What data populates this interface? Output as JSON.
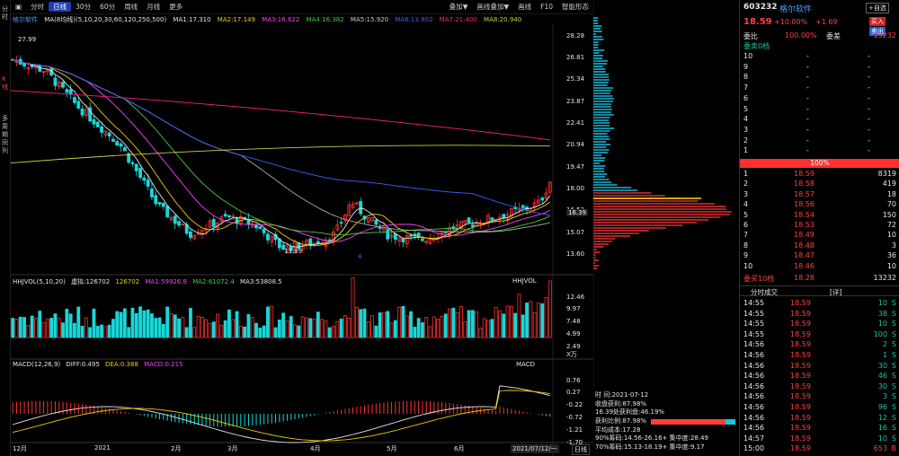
{
  "left_tabs": [
    "分时",
    "K线",
    "多周期同列"
  ],
  "toolbar": {
    "items": [
      "分时",
      "日线",
      "30分",
      "60分",
      "周线",
      "月线",
      "更多"
    ],
    "right_items": [
      "叠加▼",
      "画线叠加▼",
      "画线",
      "F10",
      "智能形态"
    ]
  },
  "ma_legend": {
    "name": "格尔软件",
    "label": "MA(8均线)(5,10,20,30,60,120,250,500)",
    "values": [
      {
        "text": "MA1:17.310",
        "color": "#e6e6e6"
      },
      {
        "text": "MA2:17.149",
        "color": "#f0d000"
      },
      {
        "text": "MA3:16.622",
        "color": "#ff40ff"
      },
      {
        "text": "MA4:16.382",
        "color": "#40d040"
      },
      {
        "text": "MA5:15.920",
        "color": "#cccccc"
      },
      {
        "text": "MA6:13.902",
        "color": "#4060ff"
      },
      {
        "text": "MA7:21.400",
        "color": "#ff2080"
      },
      {
        "text": "MA8:20.940",
        "color": "#d0d040"
      }
    ]
  },
  "price_axis": [
    "28.28",
    "26.81",
    "25.34",
    "23.87",
    "22.41",
    "20.94",
    "19.47",
    "18.00",
    "16.53",
    "15.07",
    "13.60"
  ],
  "price_markers": {
    "high": "27.99",
    "low": "13.89",
    "current": "16.39",
    "marker_4": "4"
  },
  "vol_legend": {
    "label": "HHJVOL(5,10,20)",
    "values": [
      {
        "text": "虚拟:126702",
        "color": "#e6e6e6"
      },
      {
        "text": "126702",
        "color": "#f0d000"
      },
      {
        "text": "MA1:59926.8",
        "color": "#ff40ff"
      },
      {
        "text": "MA2:61072.4",
        "color": "#40d040"
      },
      {
        "text": "MA3:53808.5",
        "color": "#e6e6e6"
      }
    ],
    "right_label": "HHJVOL"
  },
  "vol_axis": [
    "12.46",
    "9.97",
    "7.48",
    "4.99",
    "2.49",
    "X万"
  ],
  "macd_legend": {
    "label": "MACD(12,26,9)",
    "values": [
      {
        "text": "DIFF:0.495",
        "color": "#e6e6e6"
      },
      {
        "text": "DEA:0.388",
        "color": "#f0d000"
      },
      {
        "text": "MACD:0.215",
        "color": "#ff40ff"
      }
    ],
    "right_label": "MACD"
  },
  "macd_axis": [
    "0.76",
    "0.27",
    "-0.22",
    "-0.72",
    "-1.21",
    "-1.70"
  ],
  "date_axis": [
    "12月",
    "2021",
    "2月",
    "3月",
    "4月",
    "5月",
    "6月"
  ],
  "date_current": "2021/07/12/一",
  "date_period": "日线",
  "chip_info": {
    "date": "时    间:2021-07-12",
    "lines": [
      "收盘获利:87.98%",
      "16.39处获利盘:46.19%",
      "获利比例:87.98%",
      "平均成本:17.28",
      "90%筹码:14.56-26.16+ 集中度:28.49",
      "70%筹码:15.13-18.19+ 集中度:9.17"
    ]
  },
  "quote": {
    "code": "603232",
    "name": "格尔软件",
    "self_select": "+自选",
    "price": "18.59",
    "change_pct": "+10.00%",
    "change": "+1.69",
    "buy_label": "买入",
    "sell_label": "卖出",
    "weibi_label": "委比",
    "weibi": "100.00%",
    "weicha_label": "委差",
    "weicha": "13232",
    "sell_total_label": "委卖0档",
    "sell_rows": [
      {
        "n": "10",
        "p": "-",
        "v": "-"
      },
      {
        "n": "9",
        "p": "-",
        "v": "-"
      },
      {
        "n": "8",
        "p": "-",
        "v": "-"
      },
      {
        "n": "7",
        "p": "-",
        "v": "-"
      },
      {
        "n": "6",
        "p": "-",
        "v": "-"
      },
      {
        "n": "5",
        "p": "-",
        "v": "-"
      },
      {
        "n": "4",
        "p": "-",
        "v": "-"
      },
      {
        "n": "3",
        "p": "-",
        "v": "-"
      },
      {
        "n": "2",
        "p": "-",
        "v": "-"
      },
      {
        "n": "1",
        "p": "-",
        "v": "-"
      }
    ],
    "ratio_bar": "100%",
    "buy_rows": [
      {
        "n": "1",
        "p": "18.59",
        "v": "8319"
      },
      {
        "n": "2",
        "p": "18.58",
        "v": "419"
      },
      {
        "n": "3",
        "p": "18.57",
        "v": "18"
      },
      {
        "n": "4",
        "p": "18.56",
        "v": "70"
      },
      {
        "n": "5",
        "p": "18.54",
        "v": "150"
      },
      {
        "n": "6",
        "p": "18.53",
        "v": "72"
      },
      {
        "n": "7",
        "p": "18.49",
        "v": "10"
      },
      {
        "n": "8",
        "p": "18.48",
        "v": "3"
      },
      {
        "n": "9",
        "p": "18.47",
        "v": "36"
      },
      {
        "n": "10",
        "p": "18.46",
        "v": "10"
      }
    ],
    "buy_total_label": "委买10档",
    "buy_total_price": "18.28",
    "buy_total_vol": "13232",
    "ticks_tab": "分时成交",
    "ticks_tab2": "[详]",
    "ticks": [
      {
        "t": "14:55",
        "p": "18.59",
        "v": "10",
        "f": "S"
      },
      {
        "t": "14:55",
        "p": "18.59",
        "v": "38",
        "f": "S"
      },
      {
        "t": "14:55",
        "p": "18.59",
        "v": "10",
        "f": "S"
      },
      {
        "t": "14:55",
        "p": "18.59",
        "v": "100",
        "f": "S"
      },
      {
        "t": "14:56",
        "p": "18.59",
        "v": "2",
        "f": "S"
      },
      {
        "t": "14:56",
        "p": "18.59",
        "v": "1",
        "f": "S"
      },
      {
        "t": "14:56",
        "p": "18.59",
        "v": "30",
        "f": "S"
      },
      {
        "t": "14:56",
        "p": "18.59",
        "v": "46",
        "f": "S"
      },
      {
        "t": "14:56",
        "p": "18.59",
        "v": "30",
        "f": "S"
      },
      {
        "t": "14:56",
        "p": "18.59",
        "v": "3",
        "f": "S"
      },
      {
        "t": "14:56",
        "p": "18.59",
        "v": "96",
        "f": "S"
      },
      {
        "t": "14:56",
        "p": "18.59",
        "v": "12",
        "f": "S"
      },
      {
        "t": "14:56",
        "p": "18.59",
        "v": "16",
        "f": "S"
      },
      {
        "t": "14:57",
        "p": "18.59",
        "v": "10",
        "f": "S"
      },
      {
        "t": "15:00",
        "p": "18.59",
        "v": "653",
        "f": "B"
      }
    ]
  }
}
